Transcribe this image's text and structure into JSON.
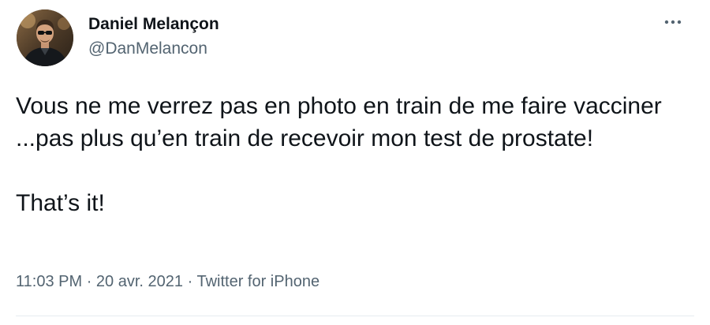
{
  "author": {
    "display_name": "Daniel Melançon",
    "handle": "@DanMelancon",
    "avatar_icon": "profile-photo"
  },
  "more_menu": {
    "icon": "more-horizontal-icon"
  },
  "tweet": {
    "paragraphs": [
      "Vous ne me verrez pas en photo en train de me faire vacciner ...pas plus qu’en train de recevoir mon test de prostate!",
      "That’s it!"
    ]
  },
  "meta": {
    "time": "11:03 PM",
    "separator": "·",
    "date": "20 avr. 2021",
    "source": "Twitter for iPhone"
  },
  "colors": {
    "text_primary": "#0f1419",
    "text_secondary": "#536471",
    "divider": "#e6ecf0"
  }
}
